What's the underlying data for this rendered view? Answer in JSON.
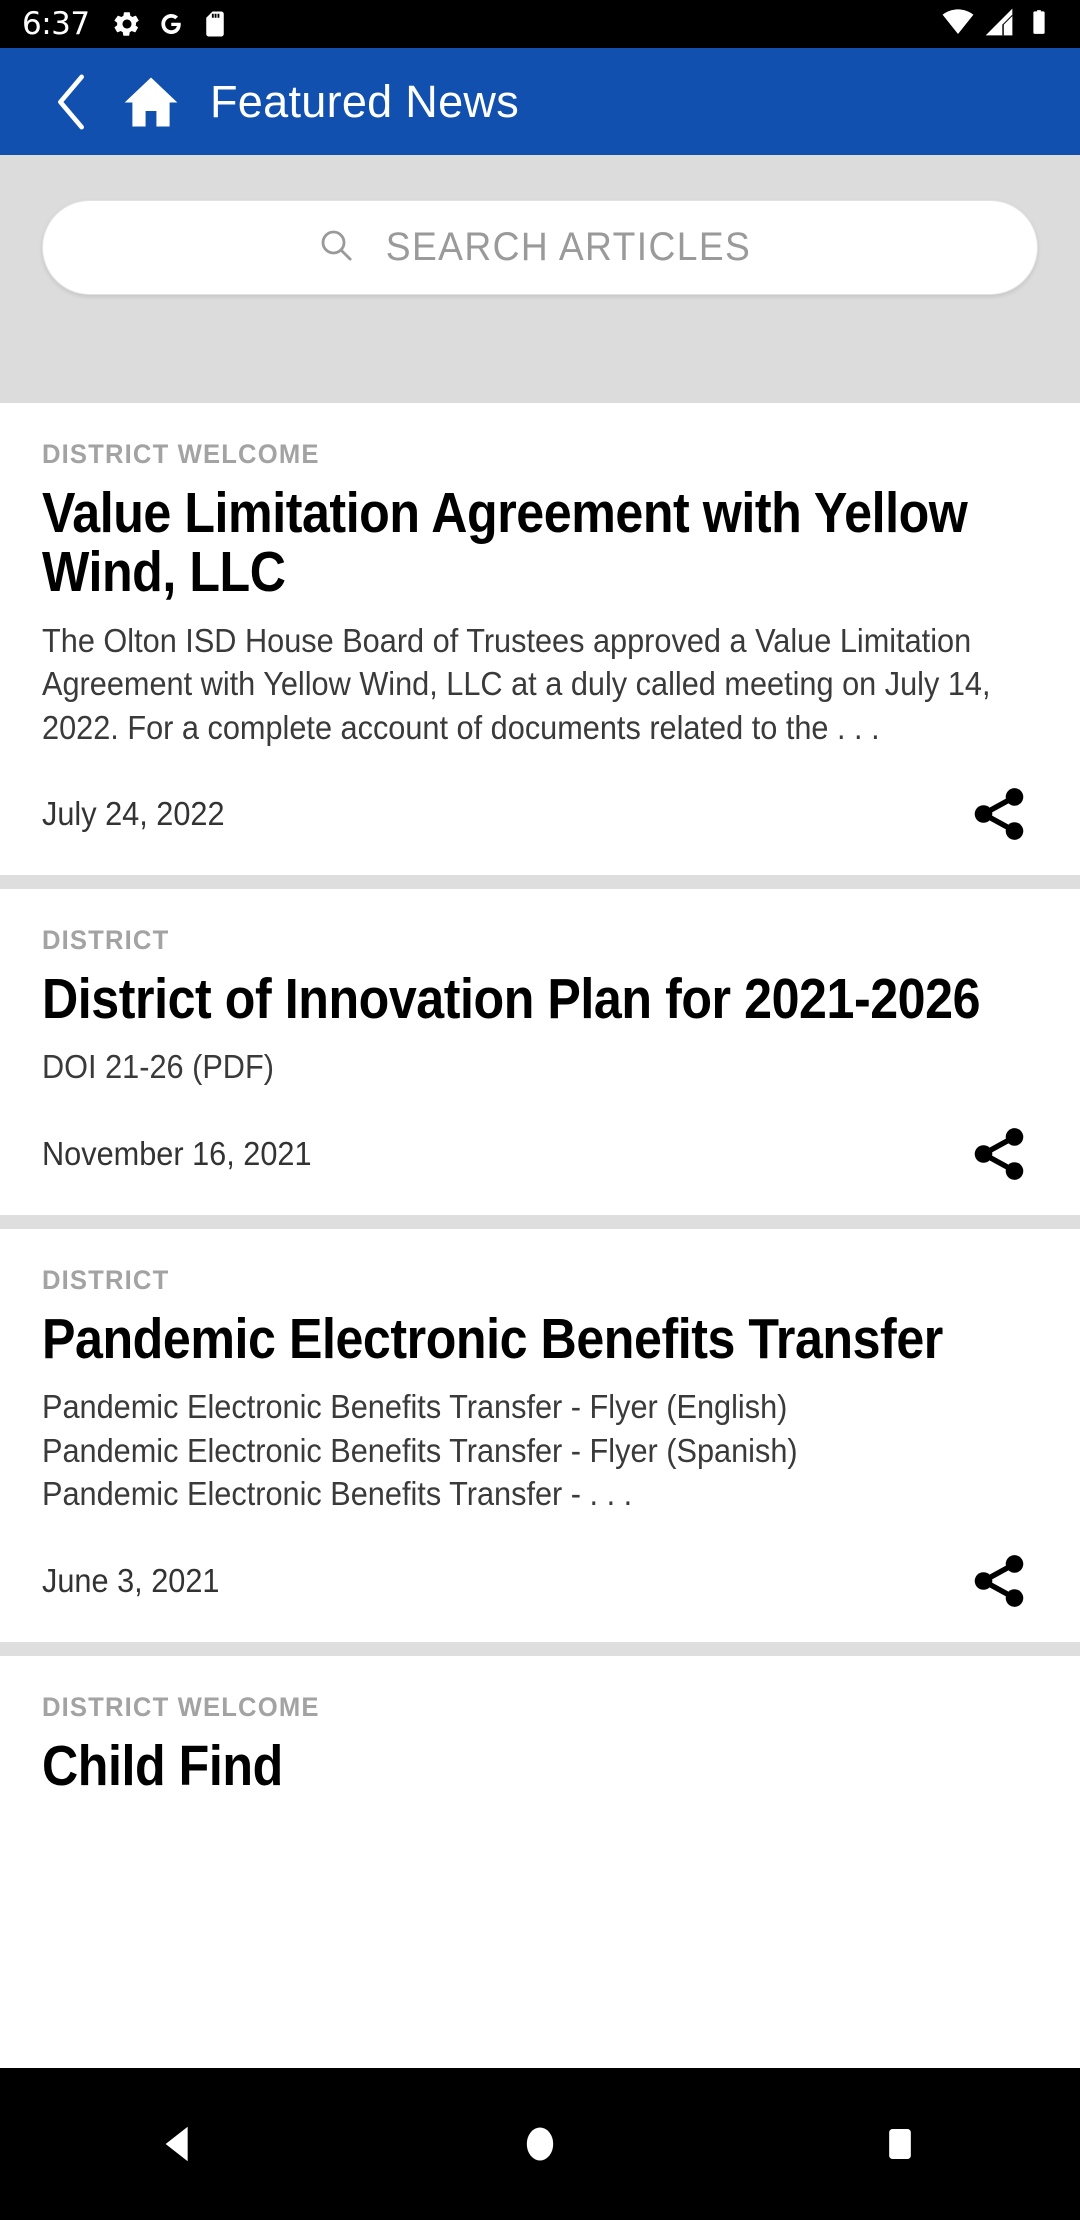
{
  "status_bar": {
    "time": "6:37",
    "left_icons": [
      "gear-icon",
      "google-g-icon",
      "sd-card-icon"
    ],
    "right_icons": [
      "wifi-icon",
      "cellular-signal-icon",
      "battery-icon"
    ]
  },
  "app_bar": {
    "title": "Featured News",
    "back_icon": "back-chevron-icon",
    "home_icon": "home-icon",
    "background_color": "#1150ae"
  },
  "search": {
    "placeholder": "SEARCH ARTICLES",
    "value": "",
    "icon": "search-icon"
  },
  "articles": [
    {
      "category": "DISTRICT WELCOME",
      "headline": "Value Limitation Agreement with Yellow Wind, LLC",
      "summary": "The Olton ISD House Board of Trustees approved a Value Limitation Agreement with Yellow Wind, LLC at a duly called meeting on July 14, 2022. For a complete account of documents related to the . . .",
      "date": "July 24, 2022",
      "share_icon": "share-icon"
    },
    {
      "category": "DISTRICT",
      "headline": "District of Innovation Plan for 2021-2026",
      "summary": "DOI 21-26 (PDF)",
      "date": "November 16, 2021",
      "share_icon": "share-icon"
    },
    {
      "category": "DISTRICT",
      "headline": "Pandemic Electronic Benefits Transfer",
      "summary": "Pandemic Electronic Benefits Transfer - Flyer (English)\nPandemic Electronic Benefits Transfer - Flyer (Spanish)\nPandemic Electronic Benefits Transfer - . . .",
      "date": "June 3, 2021",
      "share_icon": "share-icon"
    },
    {
      "category": "DISTRICT WELCOME",
      "headline": "Child Find",
      "summary": "",
      "date": "",
      "share_icon": "share-icon"
    }
  ],
  "nav_bar": {
    "back_label": "back-triangle-icon",
    "home_label": "home-circle-icon",
    "recents_label": "recents-square-icon"
  }
}
